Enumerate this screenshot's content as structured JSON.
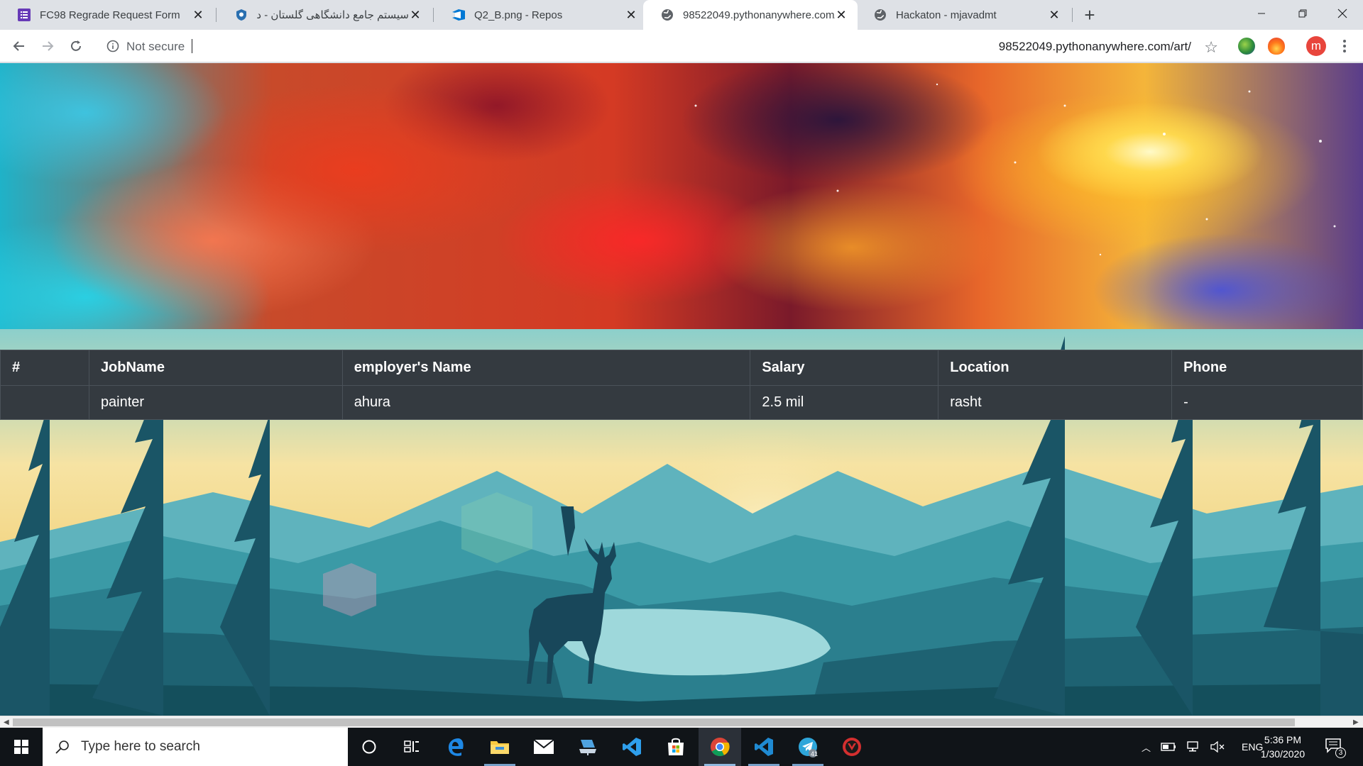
{
  "browser": {
    "tabs": [
      {
        "title": "FC98 Regrade Request Form",
        "icon": "forms-icon",
        "active": false
      },
      {
        "title": "سیستم جامع دانشگاهی گلستان - دا",
        "icon": "university-shield-icon",
        "active": false
      },
      {
        "title": "Q2_B.png - Repos",
        "icon": "azure-devops-icon",
        "active": false
      },
      {
        "title": "98522049.pythonanywhere.com/",
        "icon": "globe-icon",
        "active": true
      },
      {
        "title": "Hackaton - mjavadmt",
        "icon": "globe-icon",
        "active": false
      }
    ],
    "new_tab_label": "+",
    "security_label": "Not secure",
    "url": "98522049.pythonanywhere.com/art/",
    "profile_initial": "m",
    "colors": {
      "tabstrip": "#dee1e6",
      "avatar": "#e8453c"
    }
  },
  "table": {
    "headers": [
      "#",
      "JobName",
      "employer's Name",
      "Salary",
      "Location",
      "Phone"
    ],
    "rows": [
      {
        "num": "",
        "job": "painter",
        "employer": "ahura",
        "salary": "2.5 mil",
        "location": "rasht",
        "phone": "-"
      }
    ],
    "colors": {
      "background": "#343a40",
      "border": "#4b5259",
      "text": "#ffffff"
    }
  },
  "taskbar": {
    "search_placeholder": "Type here to search",
    "apps": [
      "cortana-icon",
      "task-view-icon",
      "edge-icon",
      "file-explorer-icon",
      "mail-icon",
      "network-drive-icon",
      "vscode-icon",
      "store-icon",
      "chrome-icon",
      "vscode-insiders-icon",
      "telegram-icon",
      "vpn-shield-icon"
    ],
    "telegram_badge": "41",
    "language": "ENG",
    "time": "5:36 PM",
    "date": "1/30/2020",
    "notification_count": "3"
  }
}
